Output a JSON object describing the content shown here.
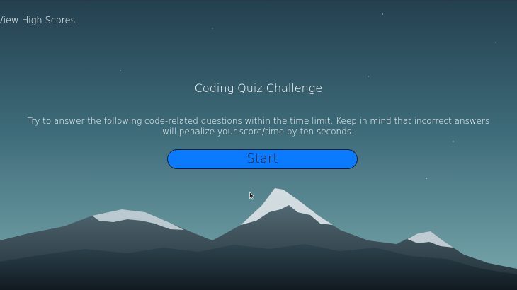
{
  "header": {
    "high_scores_label": "View High Scores"
  },
  "main": {
    "title": "Coding Quiz Challenge",
    "description": "Try to answer the following code-related questions within the time limit. Keep in mind that incorrect answers will penalize your score/time by ten seconds!",
    "start_label": "Start"
  },
  "colors": {
    "start_button": "#0a7bff",
    "sky_top": "#2f5566",
    "sky_bottom": "#6f9fa6",
    "text": "#ffffff"
  }
}
